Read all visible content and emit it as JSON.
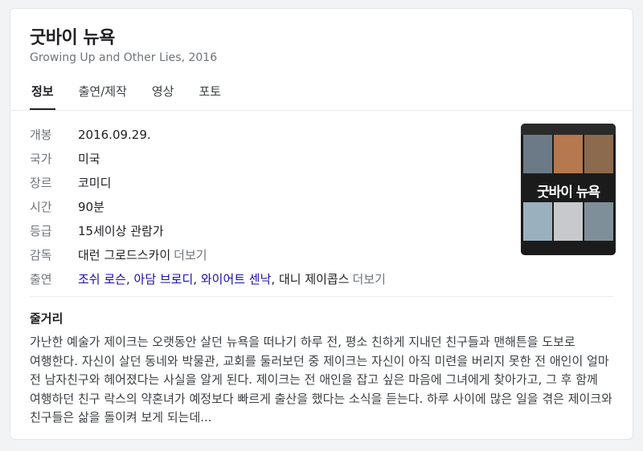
{
  "movie": {
    "title": "굿바이 뉴욕",
    "subtitle": "Growing Up and Other Lies, 2016"
  },
  "tabs": [
    {
      "label": "정보",
      "active": true
    },
    {
      "label": "출연/제작",
      "active": false
    },
    {
      "label": "영상",
      "active": false
    },
    {
      "label": "포토",
      "active": false
    }
  ],
  "info": {
    "release": {
      "label": "개봉",
      "value": "2016.09.29."
    },
    "country": {
      "label": "국가",
      "value": "미국"
    },
    "genre": {
      "label": "장르",
      "value": "코미디"
    },
    "runtime": {
      "label": "시간",
      "value": "90분"
    },
    "rating": {
      "label": "등급",
      "value": "15세이상 관람가"
    },
    "director": {
      "label": "감독",
      "value": "대런 그로드스카이",
      "more": "더보기"
    },
    "cast": {
      "label": "출연",
      "names": [
        "조쉬 로슨",
        "아담 브로디",
        "와이어트 센낙",
        "대니 제이콥스"
      ],
      "more": "더보기"
    }
  },
  "poster": {
    "title": "굿바이 뉴욕"
  },
  "synopsis": {
    "heading": "줄거리",
    "text": "가난한 예술가 제이크는 오랫동안 살던 뉴욕을 떠나기 하루 전, 평소 친하게 지내던 친구들과 맨해튼을 도보로 여행한다. 자신이 살던 동네와 박물관, 교회를 둘러보던 중 제이크는 자신이 아직 미련을 버리지 못한 전 애인이 얼마 전 남자친구와 헤어졌다는 사실을 알게 된다. 제이크는 전 애인을 잡고 싶은 마음에 그녀에게 찾아가고, 그 후 함께 여행하던 친구 락스의 약혼녀가 예정보다 빠르게 출산을 했다는 소식을 듣는다. 하루 사이에 많은 일을 겪은 제이크와 친구들은 삶을 돌이켜 보게 되는데..."
  },
  "colors": {
    "link": "#1a0dab",
    "label": "#70757a",
    "poster_accent": "#3a8ee6"
  }
}
